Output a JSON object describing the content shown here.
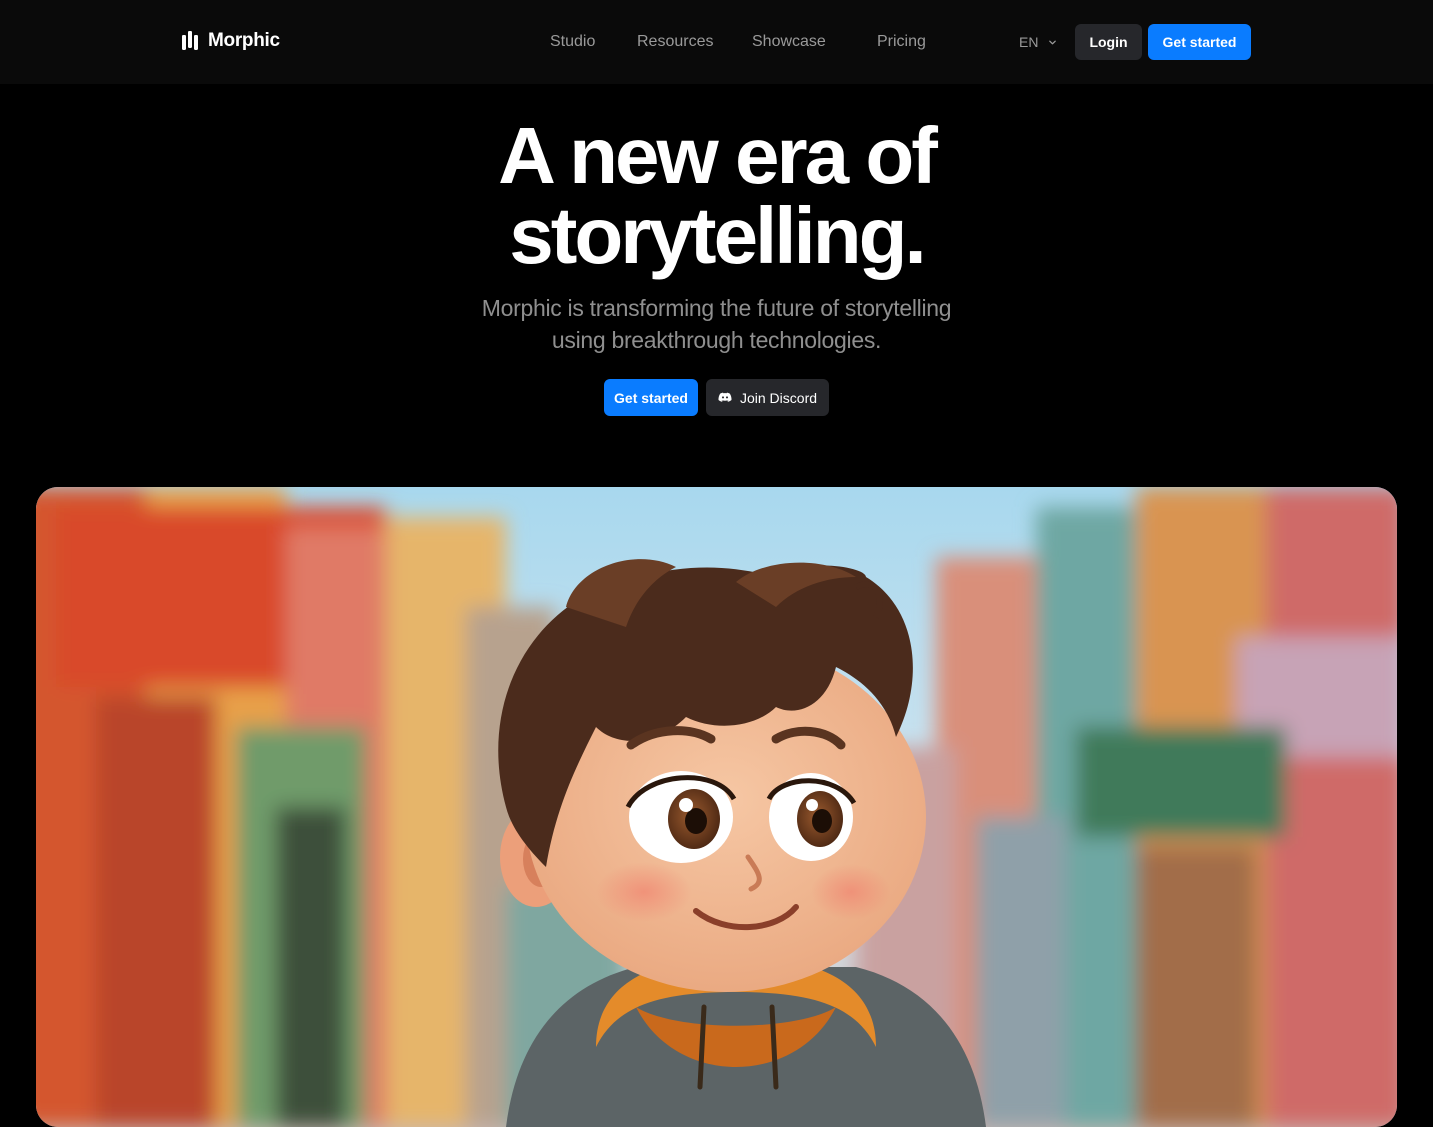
{
  "brand": {
    "name": "Morphic",
    "logo_icon": "morphic-logo-icon"
  },
  "nav": {
    "items": [
      "Studio",
      "Resources",
      "Showcase",
      "Pricing"
    ],
    "language": "EN",
    "login_label": "Login",
    "get_started_label": "Get started"
  },
  "hero": {
    "title_line1": "A new era of",
    "title_line2": "storytelling.",
    "subtitle_line1": "Morphic is transforming the future of storytelling",
    "subtitle_line2": "using breakthrough technologies.",
    "cta_primary": "Get started",
    "cta_secondary": "Join Discord",
    "cta_secondary_icon": "discord-icon"
  },
  "colors": {
    "background": "#000000",
    "accent": "#0a7cff",
    "secondary_button": "#26272b",
    "muted_text": "#8f8f8f"
  }
}
